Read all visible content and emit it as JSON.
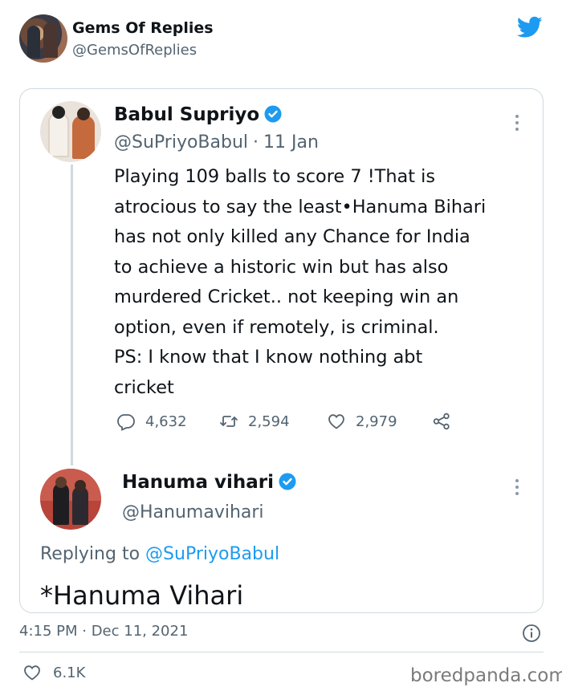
{
  "outer_tweet": {
    "name": "Gems Of Replies",
    "handle": "@GemsOfReplies",
    "timestamp": "4:15 PM · Dec 11, 2021",
    "likes": "6.1K"
  },
  "quoted_tweet": {
    "name": "Babul Supriyo",
    "handle": "@SuPriyoBabul",
    "date": "11 Jan",
    "body_lines": [
      "Playing 109 balls to score 7 !That is",
      "atrocious to say the least•Hanuma Bihari",
      "has not only killed any Chance for India",
      "to achieve a historic win but has also",
      "murdered Cricket.. not keeping win an",
      "option, even if remotely, is criminal.",
      "PS: I know that I know nothing abt",
      "cricket"
    ],
    "replies": "4,632",
    "retweets": "2,594",
    "likes": "2,979"
  },
  "reply_tweet": {
    "name": "Hanuma vihari",
    "handle": "@Hanumavihari",
    "replying_prefix": "Replying to",
    "replying_to": "@SuPriyoBabul",
    "text": "*Hanuma Vihari"
  },
  "watermark": "boredpanda.com",
  "colors": {
    "twitter_blue": "#1d9bf0",
    "text": "#0f1419",
    "muted": "#536471",
    "border": "#cfd9de"
  },
  "icons": [
    "twitter-bird-icon",
    "verified-badge-icon",
    "more-options-icon",
    "reply-icon",
    "retweet-icon",
    "like-icon",
    "share-icon",
    "info-icon",
    "heart-icon"
  ]
}
